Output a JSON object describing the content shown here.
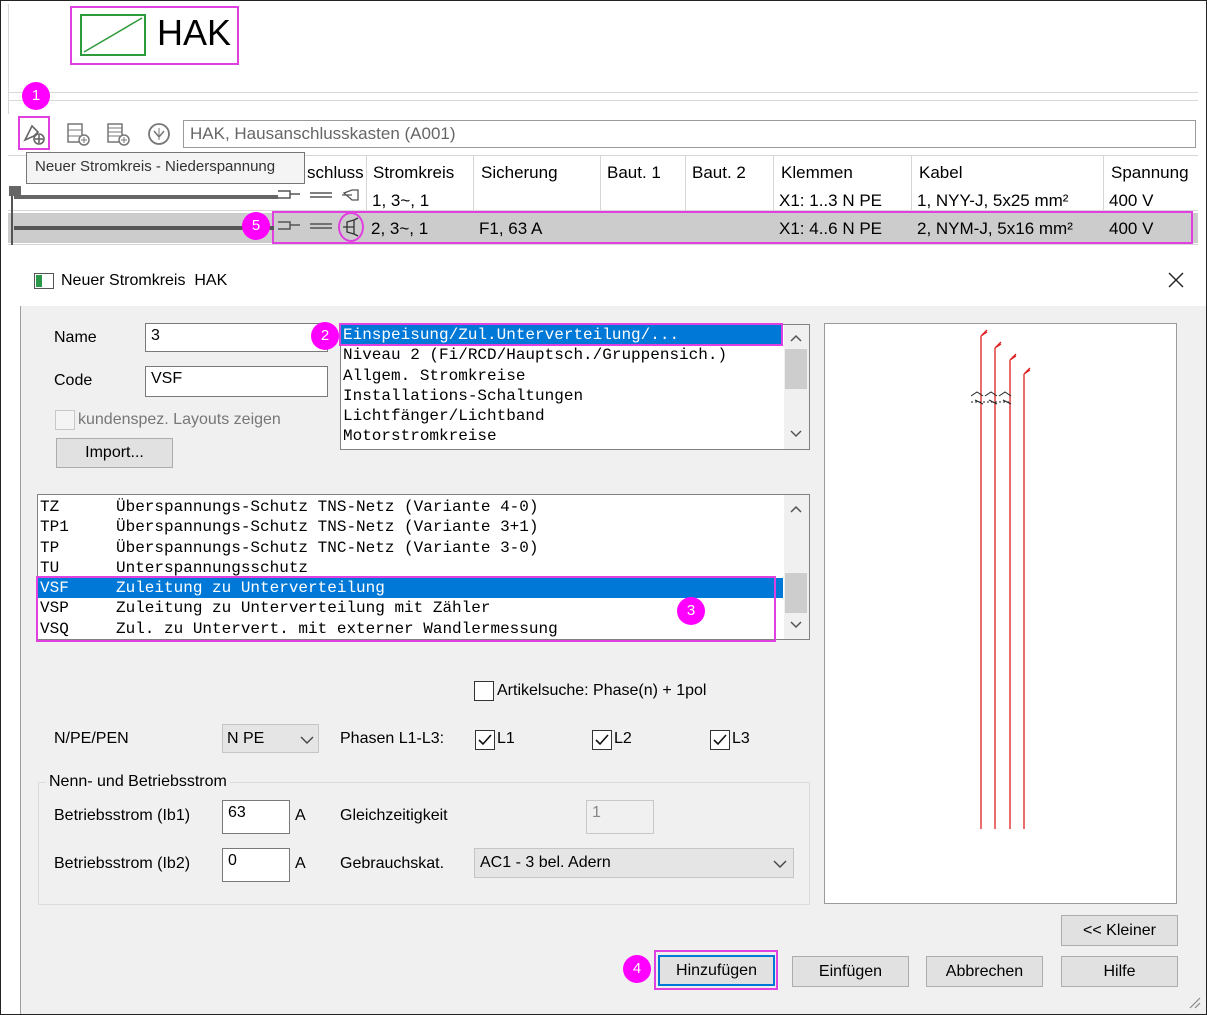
{
  "header": {
    "title": "HAK"
  },
  "toolbar": {
    "icons": [
      "new-circuit-icon",
      "circuit-icon-2",
      "circuit-icon-3",
      "network-icon"
    ],
    "path_value": "HAK, Hausanschlusskasten (A001)",
    "tooltip": "Neuer Stromkreis - Niederspannung"
  },
  "grid": {
    "columns": [
      "schluss",
      "Stromkreis",
      "Sicherung",
      "Baut. 1",
      "Baut. 2",
      "Klemmen",
      "Kabel",
      "Spannung"
    ],
    "rows": [
      {
        "stromkreis": "1, 3~, 1",
        "sicherung": "",
        "baut1": "",
        "baut2": "",
        "klemmen": "X1: 1..3 N PE",
        "kabel": "1, NYY-J, 5x25 mm²",
        "spannung": "400 V"
      },
      {
        "stromkreis": "2, 3~, 1",
        "sicherung": "F1, 63 A",
        "baut1": "",
        "baut2": "",
        "klemmen": "X1: 4..6 N PE",
        "kabel": "2, NYM-J, 5x16 mm²",
        "spannung": "400 V"
      }
    ]
  },
  "badges": [
    "1",
    "2",
    "3",
    "4",
    "5"
  ],
  "dialog": {
    "title": "Neuer Stromkreis  HAK",
    "name_label": "Name",
    "name_value": "3",
    "code_label": "Code",
    "code_value": "VSF",
    "custom_layouts_label": "kundenspez. Layouts zeigen",
    "import_button": "Import...",
    "categories": [
      "Einspeisung/Zul.Unterverteilung/...",
      "Niveau 2 (Fi/RCD/Hauptsch./Gruppensich.)",
      "Allgem. Stromkreise",
      "Installations-Schaltungen",
      "Lichtfänger/Lichtband",
      "Motorstromkreise"
    ],
    "selected_category_index": 0,
    "types": [
      {
        "code": "TZ",
        "desc": "Überspannungs-Schutz TNS-Netz (Variante 4-0)"
      },
      {
        "code": "TP1",
        "desc": "Überspannungs-Schutz TNS-Netz (Variante 3+1)"
      },
      {
        "code": "TP",
        "desc": "Überspannungs-Schutz TNC-Netz (Variante 3-0)"
      },
      {
        "code": "TU",
        "desc": "Unterspannungsschutz"
      },
      {
        "code": "VSF",
        "desc": "Zuleitung zu Unterverteilung"
      },
      {
        "code": "VSP",
        "desc": "Zuleitung zu Unterverteilung mit Zähler"
      },
      {
        "code": "VSQ",
        "desc": "Zul. zu Untervert. mit externer Wandlermessung"
      }
    ],
    "selected_type_index": 4,
    "article_search_label": "Artikelsuche: Phase(n) + 1pol",
    "npe_label": "N/PE/PEN",
    "npe_value": "N PE",
    "phases_label": "Phasen L1-L3:",
    "phase_labels": [
      "L1",
      "L2",
      "L3"
    ],
    "group_title": "Nenn- und Betriebsstrom",
    "ib1_label": "Betriebsstrom (Ib1)",
    "ib1_value": "63",
    "ib2_label": "Betriebsstrom (Ib2)",
    "ib2_value": "0",
    "unit": "A",
    "gleichzeitigkeit_label": "Gleichzeitigkeit",
    "gleichzeitigkeit_value": "1",
    "gebrauchskat_label": "Gebrauchskat.",
    "gebrauchskat_value": "AC1 - 3 bel. Adern",
    "buttons": {
      "smaller": "<< Kleiner",
      "add": "Hinzufügen",
      "insert": "Einfügen",
      "cancel": "Abbrechen",
      "help": "Hilfe"
    }
  },
  "colors": {
    "highlight": "#e040e0",
    "selection": "#0078d7",
    "badge": "#ff00ff",
    "schematic": "#e02020"
  }
}
